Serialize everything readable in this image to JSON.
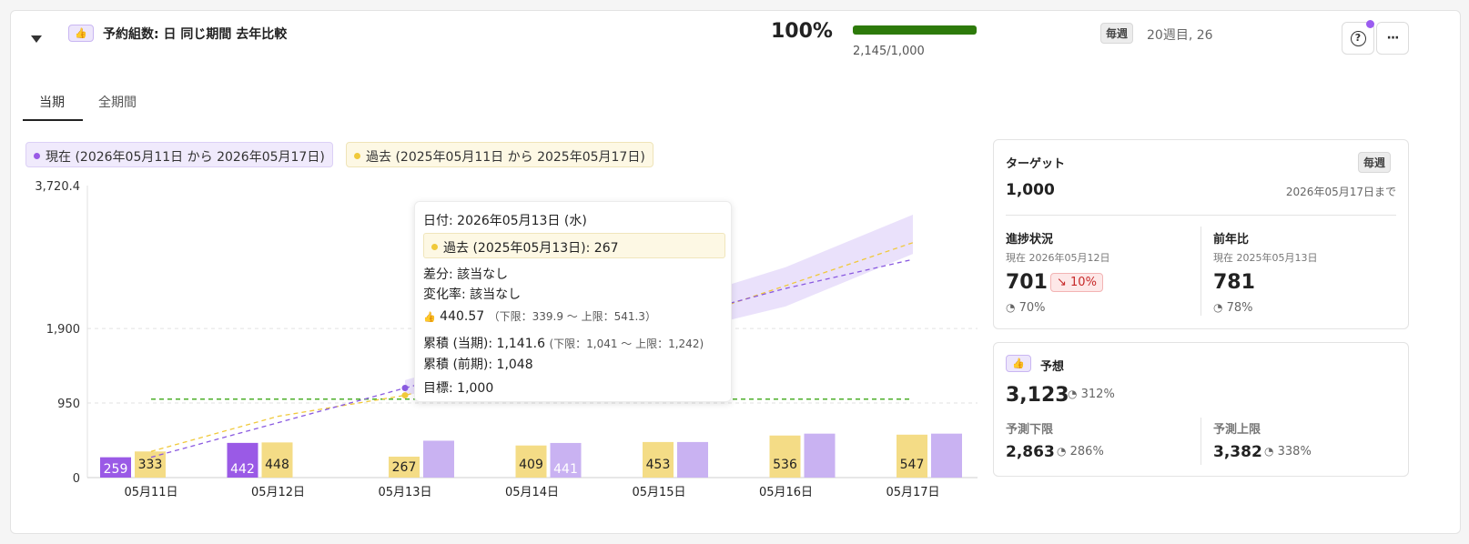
{
  "header": {
    "title": "予約組数: 日 同じ期間 去年比較",
    "kpi_icon": "👍",
    "percent": "100%",
    "progress_fraction": 1.0,
    "progress_text": "2,145/1,000",
    "frequency": "毎週",
    "week_text": "20週目, 26",
    "help_icon": "?",
    "more_icon": "···"
  },
  "tabs": [
    {
      "label": "当期",
      "active": true
    },
    {
      "label": "全期間",
      "active": false
    }
  ],
  "legend": {
    "current": "現在 (2026年05月11日 から 2026年05月17日)",
    "past": "過去 (2025年05月11日 から 2025年05月17日)"
  },
  "colors": {
    "current_dark": "#9a5ae6",
    "current_light": "#c9b2f2",
    "past": "#f4dc86",
    "target_line": "#4caf2a",
    "progress": "#2d7a0a"
  },
  "chart_data": {
    "type": "bar",
    "categories": [
      "05月11日",
      "05月12日",
      "05月13日",
      "05月14日",
      "05月15日",
      "05月16日",
      "05月17日"
    ],
    "y_ticks": [
      "3,720.4",
      "1,900",
      "950",
      "0"
    ],
    "ylim": [
      0,
      3720.4
    ],
    "series": [
      {
        "values": [
          259,
          442,
          470,
          441,
          453,
          560,
          560
        ],
        "labels": [
          "259",
          "442",
          "",
          "441",
          "",
          "",
          ""
        ]
      },
      {
        "values": [
          333,
          448,
          267,
          409,
          453,
          536,
          547
        ],
        "labels": [
          "333",
          "448",
          "267",
          "409",
          "453",
          "536",
          "547"
        ]
      }
    ],
    "target": 1000,
    "cumulative_current": [
      259,
      701,
      1141.6
    ],
    "forecast_line": [
      1141.6,
      1560,
      1980,
      2410,
      2780
    ],
    "forecast_band_upper": [
      1242,
      1700,
      2180,
      2680,
      3350
    ],
    "forecast_band_lower": [
      1041,
      1430,
      1790,
      2180,
      2850
    ],
    "cumulative_past": [
      333,
      781,
      1048,
      1457,
      1910,
      2446,
      2993
    ]
  },
  "tooltip": {
    "date": "日付: 2026年05月13日 (水)",
    "past": "過去 (2025年05月13日): 267",
    "diff": "差分: 該当なし",
    "change_rate": "変化率: 該当なし",
    "forecast_icon": "👍",
    "forecast_value": "440.57",
    "forecast_range": "（下限：339.9 ～ 上限：541.3）",
    "cum_current": "累積 (当期): 1,141.6",
    "cum_current_range": "(下限：1,041 ～ 上限：1,242)",
    "cum_past": "累積 (前期): 1,048",
    "target": "目標: 1,000"
  },
  "target_panel": {
    "label": "ターゲット",
    "frequency": "毎週",
    "value": "1,000",
    "until": "2026年05月17日まで",
    "progress_label": "進捗状況",
    "progress_sub": "現在 2026年05月12日",
    "progress_value": "701",
    "progress_change": "↘ 10%",
    "progress_pct": "70%",
    "yoy_label": "前年比",
    "yoy_sub": "現在 2025年05月13日",
    "yoy_value": "781",
    "yoy_pct": "78%"
  },
  "forecast_panel": {
    "icon": "👍",
    "label": "予想",
    "value": "3,123",
    "pct": "312%",
    "lower_label": "予測下限",
    "lower_value": "2,863",
    "lower_pct": "286%",
    "upper_label": "予測上限",
    "upper_value": "3,382",
    "upper_pct": "338%"
  }
}
